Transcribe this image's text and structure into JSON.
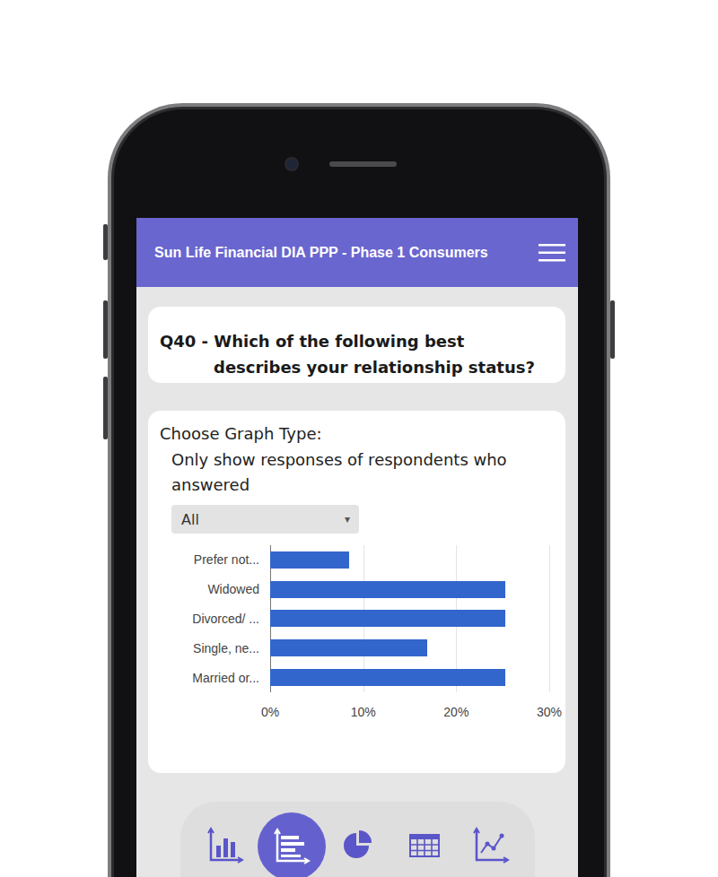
{
  "header": {
    "title": "Sun Life Financial DIA PPP - Phase 1 Consumers"
  },
  "question": {
    "text": "Q40 - Which of the following best describes your relationship status?"
  },
  "graph_panel": {
    "label": "Choose Graph Type:",
    "filter_label": "Only show responses of respondents who answered",
    "filter_value": "All",
    "filter_arrow": "▾"
  },
  "chart": {
    "categories": [
      "Prefer not...",
      "Widowed",
      "Divorced/ ...",
      "Single, ne...",
      "Married or..."
    ],
    "series": [
      {
        "values": [
          8.5,
          25.3,
          25.3,
          16.9,
          25.3
        ]
      }
    ],
    "axis_ticks": [
      "0%",
      "10%",
      "20%",
      "30%"
    ]
  },
  "graph_types": [
    {
      "kind": "column",
      "selected": false
    },
    {
      "kind": "bar",
      "selected": true
    },
    {
      "kind": "pie",
      "selected": false
    },
    {
      "kind": "table",
      "selected": false
    },
    {
      "kind": "line",
      "selected": false
    }
  ]
}
